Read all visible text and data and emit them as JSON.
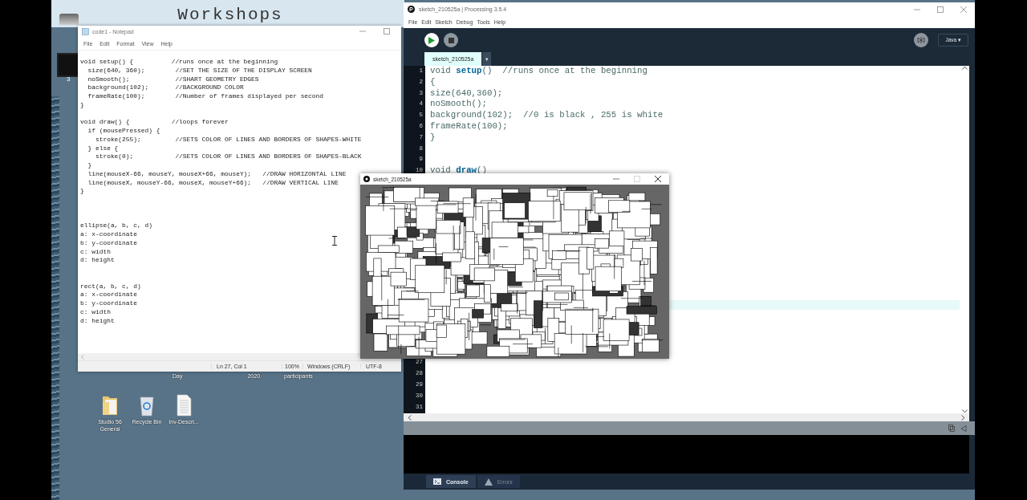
{
  "desktop": {
    "banner_title": "Workshops",
    "picture_label": "3",
    "partial_labels": [
      "Day",
      "2020",
      "participants"
    ],
    "icons": [
      {
        "kind": "folder",
        "label": "Studio 56 General"
      },
      {
        "kind": "recycle-bin",
        "label": "Recycle Bin"
      },
      {
        "kind": "document",
        "label": "Inv-Descri..."
      }
    ]
  },
  "notepad": {
    "title": "code1 - Notepad",
    "menu": [
      "File",
      "Edit",
      "Format",
      "View",
      "Help"
    ],
    "code_blocks": [
      [
        "void setup() {          //runs once at the beginning",
        "  size(640, 360);        //SET THE SIZE OF THE DISPLAY SCREEN",
        "  noSmooth();            //SHART GEOMETRY EDGES",
        "  background(102);       //BACKGROUND COLOR",
        "  frameRate(100);        //Number of frames displayed per second",
        "}"
      ],
      [
        "void draw() {           //loops forever",
        "  if (mousePressed) {",
        "    stroke(255);         //SETS COLOR OF LINES AND BORDERS OF SHAPES-WHITE",
        "  } else {",
        "    stroke(0);           //SETS COLOR OF LINES AND BORDERS OF SHAPES-BLACK",
        "  }",
        "  line(mouseX-66, mouseY, mouseX+66, mouseY);   //DRAW HORIZONTAL LINE",
        "  line(mouseX, mouseY-66, mouseX, mouseY+66);   //DRAW VERTICAL LINE",
        "}"
      ],
      [
        "ellipse(a, b, c, d)",
        "a: x-coordinate",
        "b: y-coordinate",
        "c: width",
        "d: height"
      ],
      [
        "rect(a, b, c, d)",
        "a: x-coordinate",
        "b: y-coordinate",
        "c: width",
        "d: height"
      ]
    ],
    "status": [
      "Ln 27, Col 1",
      "100%",
      "Windows (CRLF)",
      "UTF-8"
    ]
  },
  "processing": {
    "title": "sketch_210525a | Processing 3.5.4",
    "menu": [
      "File",
      "Edit",
      "Sketch",
      "Debug",
      "Tools",
      "Help"
    ],
    "mode": "Java ▾",
    "tabs": [
      {
        "label": "sketch_210525a",
        "selected": true
      }
    ],
    "tab_menu": "▾",
    "lines": [
      {
        "number": "1",
        "code": "void **setup**()  //runs once at the beginning"
      },
      {
        "number": "2",
        "code": "{"
      },
      {
        "number": "3",
        "code": "size(640,360);"
      },
      {
        "number": "4",
        "code": "noSmooth();"
      },
      {
        "number": "5",
        "code": "background(102);  //0 is black , 255 is white"
      },
      {
        "number": "6",
        "code": "frameRate(100);"
      },
      {
        "number": "7",
        "code": "}"
      },
      {
        "number": "8"
      },
      {
        "number": "9"
      },
      {
        "number": "10",
        "code": "void **draw**()"
      }
    ],
    "lower_line_numbers": [
      "27",
      "28",
      "29",
      "30",
      "31"
    ],
    "console_tabs": [
      {
        "label": "Console",
        "selected": true
      },
      {
        "label": "Errors",
        "selected": false
      }
    ]
  },
  "sketch_window": {
    "title": "sketch_210525a"
  }
}
